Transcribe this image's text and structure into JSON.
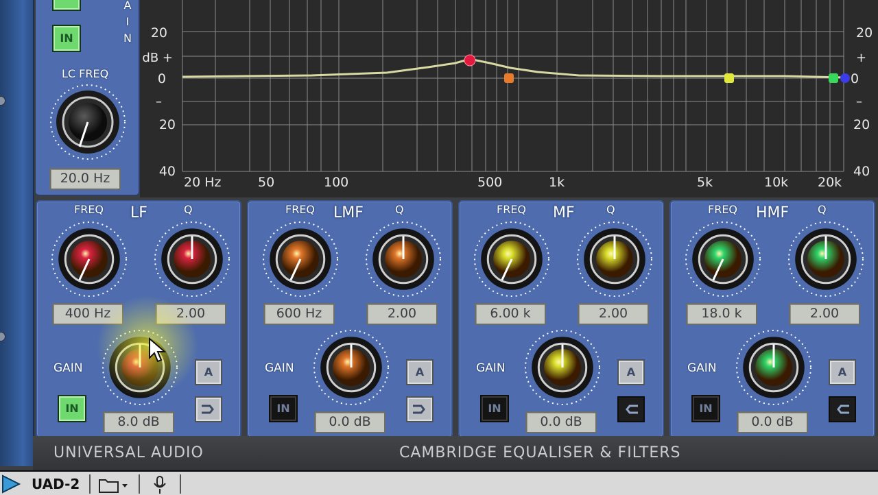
{
  "lc_panel": {
    "in_label": "IN",
    "freq_title": "LC FREQ",
    "freq_value": "20.0 Hz",
    "side_letters": [
      "A",
      "I",
      "N"
    ]
  },
  "graph": {
    "y_labels_left": [
      "20",
      "dB +",
      "0",
      "–",
      "20",
      "40"
    ],
    "y_labels_right": [
      "20",
      "+",
      "0",
      "–",
      "20",
      "40"
    ],
    "x_labels": [
      "20 Hz",
      "50",
      "100",
      "500",
      "1k",
      "5k",
      "10k",
      "20k"
    ],
    "colors": {
      "curve": "#d8d9a3",
      "grid": "#9a9a9a",
      "lf": "#e21a3f",
      "lmf": "#e87a2a",
      "mf": "#e0e83b",
      "hmf": "#38d85a",
      "hp": "#3b3be8"
    }
  },
  "bands": [
    {
      "name": "LF",
      "freq_label": "FREQ",
      "q_label": "Q",
      "freq_value": "400 Hz",
      "q_value": "2.00",
      "gain_label": "GAIN",
      "gain_value": "8.0 dB",
      "in_label": "IN",
      "in_on": true,
      "a_label": "A",
      "color": "#d8233f"
    },
    {
      "name": "LMF",
      "freq_label": "FREQ",
      "q_label": "Q",
      "freq_value": "600 Hz",
      "q_value": "2.00",
      "gain_label": "GAIN",
      "gain_value": "0.0 dB",
      "in_label": "IN",
      "in_on": false,
      "a_label": "A",
      "color": "#e0762a"
    },
    {
      "name": "MF",
      "freq_label": "FREQ",
      "q_label": "Q",
      "freq_value": "6.00 k",
      "q_value": "2.00",
      "gain_label": "GAIN",
      "gain_value": "0.0 dB",
      "in_label": "IN",
      "in_on": false,
      "a_label": "A",
      "color": "#d9de2c"
    },
    {
      "name": "HMF",
      "freq_label": "FREQ",
      "q_label": "Q",
      "freq_value": "18.0 k",
      "q_value": "2.00",
      "gain_label": "GAIN",
      "gain_value": "0.0 dB",
      "in_label": "IN",
      "in_on": false,
      "a_label": "A",
      "color": "#2fd56a"
    }
  ],
  "footer": {
    "left": "UNIVERSAL AUDIO",
    "right": "CAMBRIDGE EQUALISER & FILTERS"
  },
  "taskbar": {
    "app_label": "UAD-2"
  }
}
